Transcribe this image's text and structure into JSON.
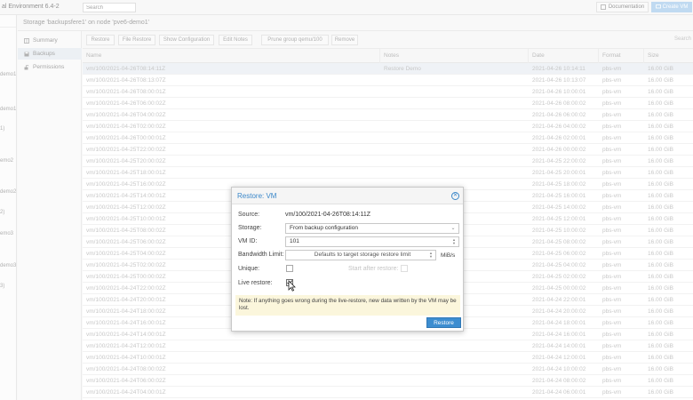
{
  "app": {
    "title": "al Environment 6.4-2",
    "search_placeholder": "Search",
    "documentation_label": "Documentation",
    "create_vm_label": "Create VM"
  },
  "tree": {
    "nodes": [
      "demo1",
      "demo1",
      "1)",
      "emo2",
      "demo2",
      "2)",
      "emo3",
      "demo3",
      "3)"
    ]
  },
  "content": {
    "title": "Storage 'backupsfere1' on node 'pve6-demo1'"
  },
  "submenu": {
    "items": [
      {
        "label": "Summary",
        "icon": "book-icon"
      },
      {
        "label": "Backups",
        "icon": "floppy-icon"
      },
      {
        "label": "Permissions",
        "icon": "unlock-icon"
      }
    ]
  },
  "toolbar": {
    "buttons": [
      "Restore",
      "File Restore",
      "Show Configuration",
      "Edit Notes",
      "Prune group qemu/100",
      "Remove"
    ],
    "search_label": "Search"
  },
  "grid": {
    "columns": [
      "Name",
      "Notes",
      "Date",
      "Format",
      "Size"
    ],
    "rows": [
      {
        "name": "vm/100/2021-04-26T08:14:11Z",
        "notes": "Restore Demo",
        "date": "2021-04-26 10:14:11",
        "format": "pbs-vm",
        "size": "16.00 GiB"
      },
      {
        "name": "vm/100/2021-04-26T08:13:07Z",
        "notes": "",
        "date": "2021-04-26 10:13:07",
        "format": "pbs-vm",
        "size": "16.00 GiB"
      },
      {
        "name": "vm/100/2021-04-26T08:00:01Z",
        "notes": "",
        "date": "2021-04-26 10:00:01",
        "format": "pbs-vm",
        "size": "16.00 GiB"
      },
      {
        "name": "vm/100/2021-04-26T06:00:02Z",
        "notes": "",
        "date": "2021-04-26 08:00:02",
        "format": "pbs-vm",
        "size": "16.00 GiB"
      },
      {
        "name": "vm/100/2021-04-26T04:00:02Z",
        "notes": "",
        "date": "2021-04-26 06:00:02",
        "format": "pbs-vm",
        "size": "16.00 GiB"
      },
      {
        "name": "vm/100/2021-04-26T02:00:02Z",
        "notes": "",
        "date": "2021-04-26 04:00:02",
        "format": "pbs-vm",
        "size": "16.00 GiB"
      },
      {
        "name": "vm/100/2021-04-26T00:00:01Z",
        "notes": "",
        "date": "2021-04-26 02:00:01",
        "format": "pbs-vm",
        "size": "16.00 GiB"
      },
      {
        "name": "vm/100/2021-04-25T22:00:02Z",
        "notes": "",
        "date": "2021-04-26 00:00:02",
        "format": "pbs-vm",
        "size": "16.00 GiB"
      },
      {
        "name": "vm/100/2021-04-25T20:00:02Z",
        "notes": "",
        "date": "2021-04-25 22:00:02",
        "format": "pbs-vm",
        "size": "16.00 GiB"
      },
      {
        "name": "vm/100/2021-04-25T18:00:01Z",
        "notes": "",
        "date": "2021-04-25 20:00:01",
        "format": "pbs-vm",
        "size": "16.00 GiB"
      },
      {
        "name": "vm/100/2021-04-25T16:00:02Z",
        "notes": "",
        "date": "2021-04-25 18:00:02",
        "format": "pbs-vm",
        "size": "16.00 GiB"
      },
      {
        "name": "vm/100/2021-04-25T14:00:01Z",
        "notes": "",
        "date": "2021-04-25 16:00:01",
        "format": "pbs-vm",
        "size": "16.00 GiB"
      },
      {
        "name": "vm/100/2021-04-25T12:00:02Z",
        "notes": "",
        "date": "2021-04-25 14:00:02",
        "format": "pbs-vm",
        "size": "16.00 GiB"
      },
      {
        "name": "vm/100/2021-04-25T10:00:01Z",
        "notes": "",
        "date": "2021-04-25 12:00:01",
        "format": "pbs-vm",
        "size": "16.00 GiB"
      },
      {
        "name": "vm/100/2021-04-25T08:00:02Z",
        "notes": "",
        "date": "2021-04-25 10:00:02",
        "format": "pbs-vm",
        "size": "16.00 GiB"
      },
      {
        "name": "vm/100/2021-04-25T06:00:02Z",
        "notes": "",
        "date": "2021-04-25 08:00:02",
        "format": "pbs-vm",
        "size": "16.00 GiB"
      },
      {
        "name": "vm/100/2021-04-25T04:00:02Z",
        "notes": "",
        "date": "2021-04-25 06:00:02",
        "format": "pbs-vm",
        "size": "16.00 GiB"
      },
      {
        "name": "vm/100/2021-04-25T02:00:02Z",
        "notes": "",
        "date": "2021-04-25 04:00:02",
        "format": "pbs-vm",
        "size": "16.00 GiB"
      },
      {
        "name": "vm/100/2021-04-25T00:00:02Z",
        "notes": "",
        "date": "2021-04-25 02:00:02",
        "format": "pbs-vm",
        "size": "16.00 GiB"
      },
      {
        "name": "vm/100/2021-04-24T22:00:02Z",
        "notes": "",
        "date": "2021-04-25 00:00:02",
        "format": "pbs-vm",
        "size": "16.00 GiB"
      },
      {
        "name": "vm/100/2021-04-24T20:00:01Z",
        "notes": "",
        "date": "2021-04-24 22:00:01",
        "format": "pbs-vm",
        "size": "16.00 GiB"
      },
      {
        "name": "vm/100/2021-04-24T18:00:02Z",
        "notes": "",
        "date": "2021-04-24 20:00:02",
        "format": "pbs-vm",
        "size": "16.00 GiB"
      },
      {
        "name": "vm/100/2021-04-24T16:00:01Z",
        "notes": "",
        "date": "2021-04-24 18:00:01",
        "format": "pbs-vm",
        "size": "16.00 GiB"
      },
      {
        "name": "vm/100/2021-04-24T14:00:01Z",
        "notes": "",
        "date": "2021-04-24 16:00:01",
        "format": "pbs-vm",
        "size": "16.00 GiB"
      },
      {
        "name": "vm/100/2021-04-24T12:00:01Z",
        "notes": "",
        "date": "2021-04-24 14:00:01",
        "format": "pbs-vm",
        "size": "16.00 GiB"
      },
      {
        "name": "vm/100/2021-04-24T10:00:01Z",
        "notes": "",
        "date": "2021-04-24 12:00:01",
        "format": "pbs-vm",
        "size": "16.00 GiB"
      },
      {
        "name": "vm/100/2021-04-24T08:00:02Z",
        "notes": "",
        "date": "2021-04-24 10:00:02",
        "format": "pbs-vm",
        "size": "16.00 GiB"
      },
      {
        "name": "vm/100/2021-04-24T06:00:02Z",
        "notes": "",
        "date": "2021-04-24 08:00:02",
        "format": "pbs-vm",
        "size": "16.00 GiB"
      },
      {
        "name": "vm/100/2021-04-24T04:00:01Z",
        "notes": "",
        "date": "2021-04-24 06:00:01",
        "format": "pbs-vm",
        "size": "16.00 GiB"
      }
    ]
  },
  "dialog": {
    "title": "Restore: VM",
    "source_label": "Source:",
    "source_value": "vm/100/2021-04-26T08:14:11Z",
    "storage_label": "Storage:",
    "storage_value": "From backup configuration",
    "vmid_label": "VM ID:",
    "vmid_value": "101",
    "bwlimit_label": "Bandwidth Limit:",
    "bwlimit_placeholder": "Defaults to target storage restore limit",
    "bwlimit_unit": "MiB/s",
    "unique_label": "Unique:",
    "unique_checked": false,
    "start_label": "Start after restore:",
    "start_checked": false,
    "live_label": "Live restore:",
    "live_checked": true,
    "note": "Note: If anything goes wrong during the live-restore, new data written by the VM may be lost.",
    "restore_label": "Restore"
  }
}
